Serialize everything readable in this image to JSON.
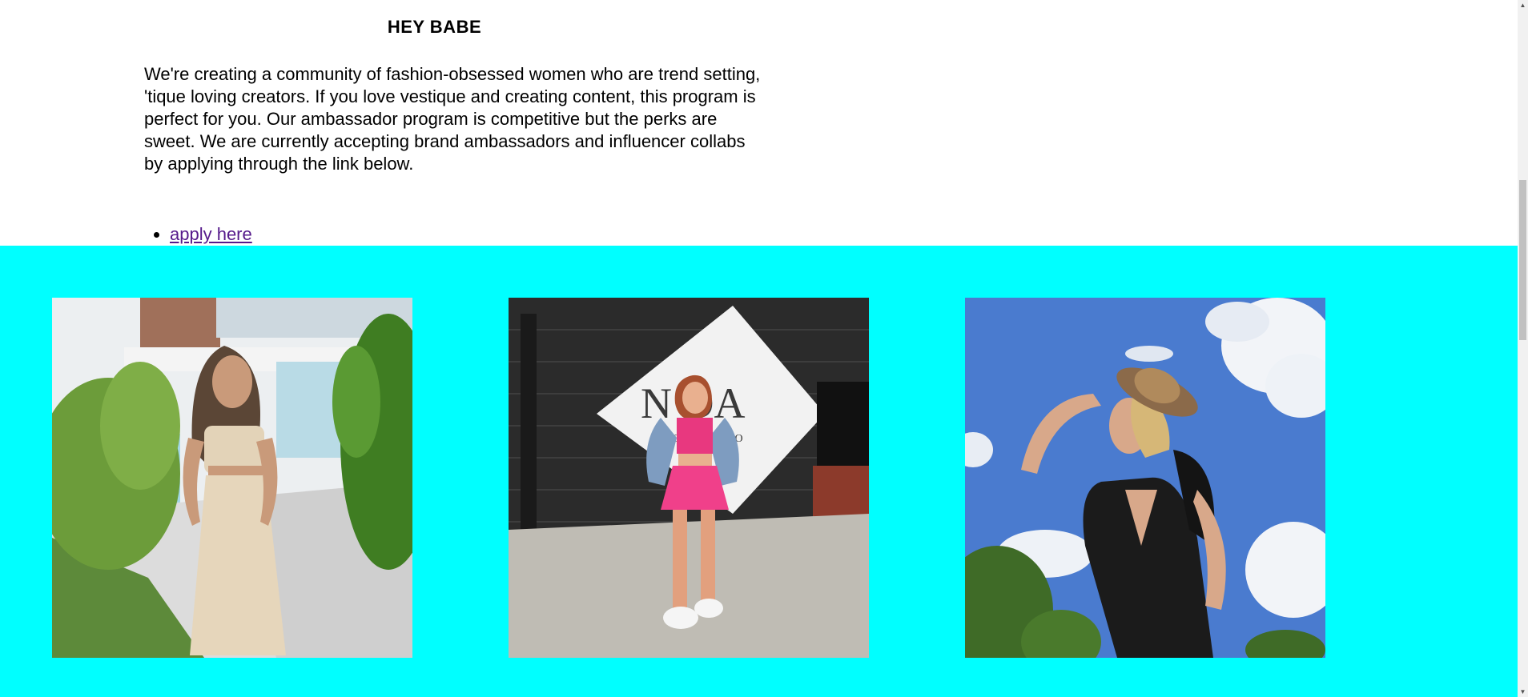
{
  "intro": {
    "heading": "HEY BABE",
    "body": "We're creating a community of fashion-obsessed women who are trend setting, 'tique loving creators. If you love vestique and creating content, this program is perfect for you. Our ambassador program is competitive but the perks are sweet. We are currently accepting brand ambassadors and influencer collabs by applying through the link below.",
    "link_label": "apply here"
  },
  "gallery": {
    "background": "#00ffff",
    "photos": [
      {
        "name": "ambassador-photo-1"
      },
      {
        "name": "ambassador-photo-2",
        "mural_text_1": "N  DA",
        "mural_text_2": "CHARLO"
      },
      {
        "name": "ambassador-photo-3"
      }
    ]
  },
  "scrollbar": {
    "up_icon": "▲",
    "down_icon": "▼"
  }
}
